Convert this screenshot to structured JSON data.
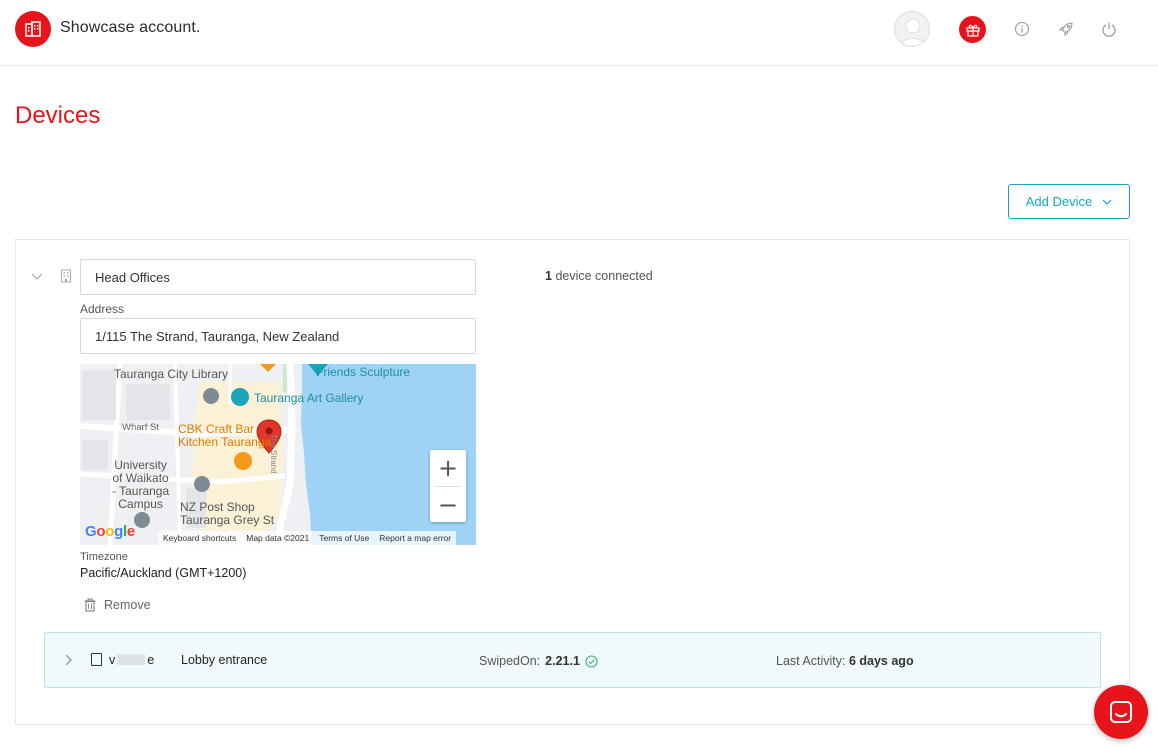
{
  "header": {
    "account_name": "Showcase account."
  },
  "page": {
    "title": "Devices"
  },
  "toolbar": {
    "add_device_label": "Add Device"
  },
  "location": {
    "name": "Head Offices",
    "devices_count": "1",
    "devices_connected_suffix": "device connected",
    "address_label": "Address",
    "address": "1/115 The Strand, Tauranga, New Zealand",
    "timezone_label": "Timezone",
    "timezone": "Pacific/Auckland (GMT+1200)",
    "remove_label": "Remove"
  },
  "map": {
    "labels": {
      "library": "Tauranga City Library",
      "sculpture": "Friends Sculpture",
      "gallery": "Tauranga Art Gallery",
      "wharf_st": "Wharf St",
      "cbk": "CBK Craft Bar\nKitchen Tauranga",
      "strand": "The Strand",
      "university": "University\nof Waikato\n- Tauranga\nCampus",
      "postshop": "NZ Post Shop\nTauranga Grey St",
      "google": "Google"
    },
    "attribution": {
      "shortcuts": "Keyboard shortcuts",
      "data": "Map data ©2021",
      "terms": "Terms of Use",
      "report": "Report a map error"
    },
    "zoom_in": "+",
    "zoom_out": "−"
  },
  "device": {
    "code_start": "v",
    "code_end": "e",
    "name": "Lobby entrance",
    "version_label": "SwipedOn:",
    "version": "2.21.1",
    "activity_label": "Last Activity:",
    "activity": "6 days ago"
  },
  "colors": {
    "brand": "#e8141b",
    "accent": "#13a7c1",
    "success": "#3cb371"
  },
  "icons": {
    "logo": "building-icon",
    "gift": "gift-icon",
    "info": "info-icon",
    "launch": "rocket-icon",
    "logout": "power-icon",
    "chat": "chat-icon"
  }
}
